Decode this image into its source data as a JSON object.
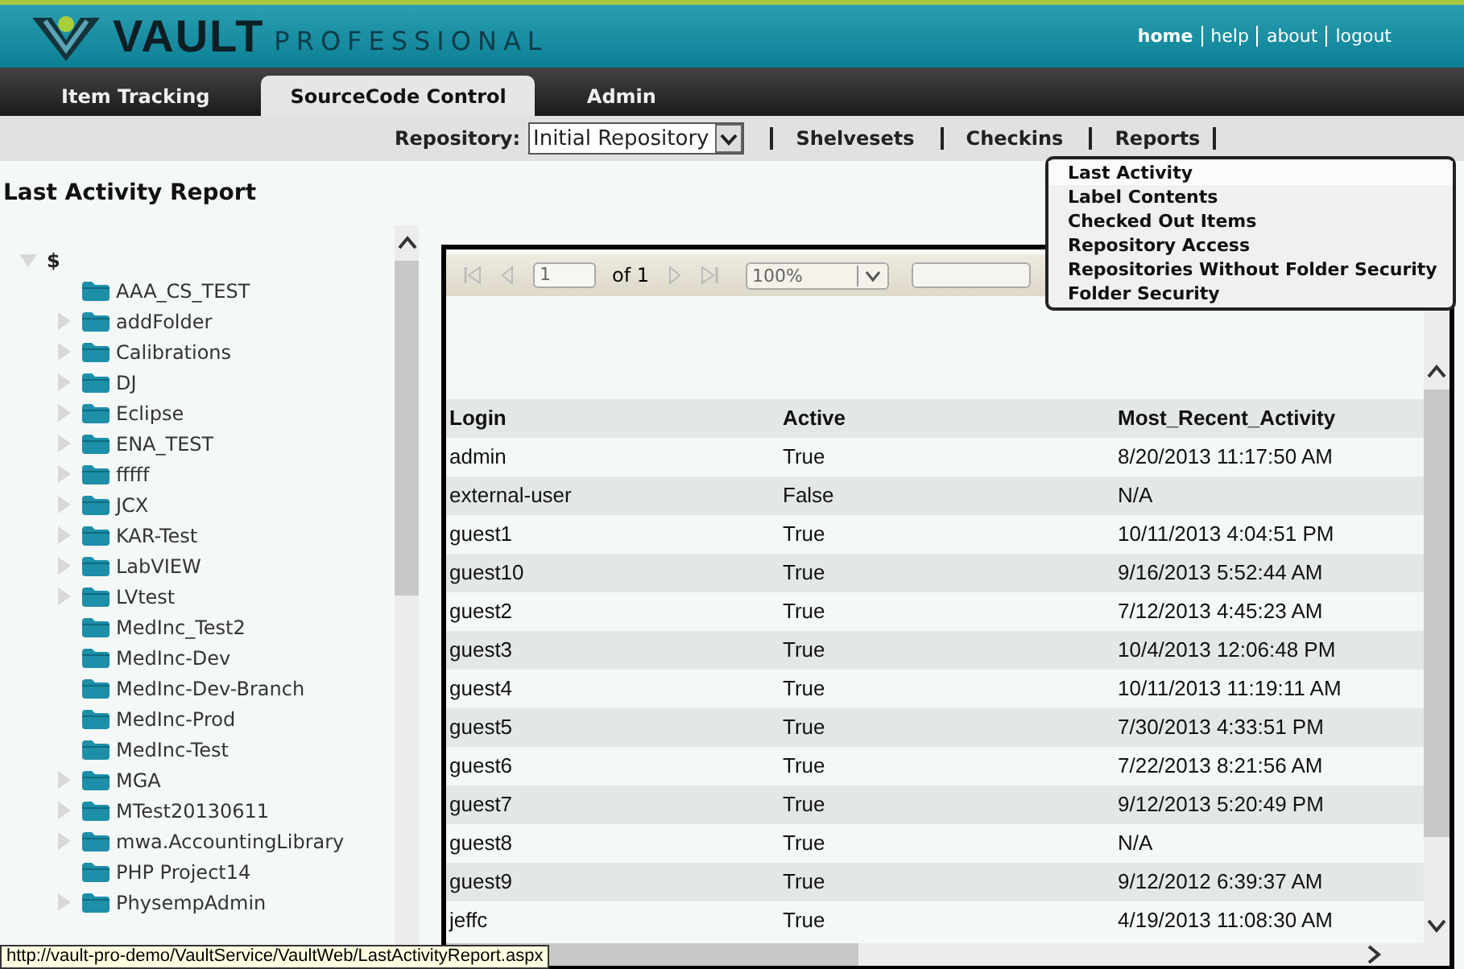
{
  "header": {
    "brand": "VAULT",
    "edition": "PROFESSIONAL",
    "links": [
      "home",
      "help",
      "about",
      "logout"
    ]
  },
  "tabs": [
    {
      "label": "Item Tracking",
      "selected": false
    },
    {
      "label": "SourceCode Control",
      "selected": true
    },
    {
      "label": "Admin",
      "selected": false
    }
  ],
  "toolbar": {
    "repository_label": "Repository:",
    "repository_value": "Initial Repository",
    "links": [
      "Shelvesets",
      "Checkins",
      "Reports"
    ]
  },
  "page_title": "Last Activity Report",
  "tree": {
    "root": {
      "label": "$",
      "expanded": true,
      "children": [
        {
          "label": "AAA_CS_TEST",
          "expandable": false
        },
        {
          "label": "addFolder",
          "expandable": true
        },
        {
          "label": "Calibrations",
          "expandable": true
        },
        {
          "label": "DJ",
          "expandable": true
        },
        {
          "label": "Eclipse",
          "expandable": true
        },
        {
          "label": "ENA_TEST",
          "expandable": true
        },
        {
          "label": "fffff",
          "expandable": true
        },
        {
          "label": "JCX",
          "expandable": true
        },
        {
          "label": "KAR-Test",
          "expandable": true
        },
        {
          "label": "LabVIEW",
          "expandable": true
        },
        {
          "label": "LVtest",
          "expandable": true
        },
        {
          "label": "MedInc_Test2",
          "expandable": false
        },
        {
          "label": "MedInc-Dev",
          "expandable": false
        },
        {
          "label": "MedInc-Dev-Branch",
          "expandable": false
        },
        {
          "label": "MedInc-Prod",
          "expandable": false
        },
        {
          "label": "MedInc-Test",
          "expandable": false
        },
        {
          "label": "MGA",
          "expandable": true
        },
        {
          "label": "MTest20130611",
          "expandable": true
        },
        {
          "label": "mwa.AccountingLibrary",
          "expandable": true
        },
        {
          "label": "PHP Project14",
          "expandable": false
        },
        {
          "label": "PhysempAdmin",
          "expandable": true
        }
      ]
    }
  },
  "report": {
    "page": "1",
    "of": "of 1",
    "zoom": "100%",
    "table": {
      "columns": [
        "Login",
        "Active",
        "Most_Recent_Activity"
      ],
      "rows": [
        [
          "admin",
          "True",
          "8/20/2013 11:17:50 AM"
        ],
        [
          "external-user",
          "False",
          "N/A"
        ],
        [
          "guest1",
          "True",
          "10/11/2013 4:04:51 PM"
        ],
        [
          "guest10",
          "True",
          "9/16/2013 5:52:44 AM"
        ],
        [
          "guest2",
          "True",
          "7/12/2013 4:45:23 AM"
        ],
        [
          "guest3",
          "True",
          "10/4/2013 12:06:48 PM"
        ],
        [
          "guest4",
          "True",
          "10/11/2013 11:19:11 AM"
        ],
        [
          "guest5",
          "True",
          "7/30/2013 4:33:51 PM"
        ],
        [
          "guest6",
          "True",
          "7/22/2013 8:21:56 AM"
        ],
        [
          "guest7",
          "True",
          "9/12/2013 5:20:49 PM"
        ],
        [
          "guest8",
          "True",
          "N/A"
        ],
        [
          "guest9",
          "True",
          "9/12/2012 6:39:37 AM"
        ],
        [
          "jeffc",
          "True",
          "4/19/2013 11:08:30 AM"
        ]
      ]
    }
  },
  "reports_menu": [
    {
      "label": "Last Activity",
      "selected": true
    },
    {
      "label": "Label Contents",
      "selected": false
    },
    {
      "label": "Checked Out Items",
      "selected": false
    },
    {
      "label": "Repository Access",
      "selected": false
    },
    {
      "label": "Repositories Without Folder Security",
      "selected": false
    },
    {
      "label": "Folder Security",
      "selected": false
    }
  ],
  "status_bar": "http://vault-pro-demo/VaultService/VaultWeb/LastActivityReport.aspx"
}
